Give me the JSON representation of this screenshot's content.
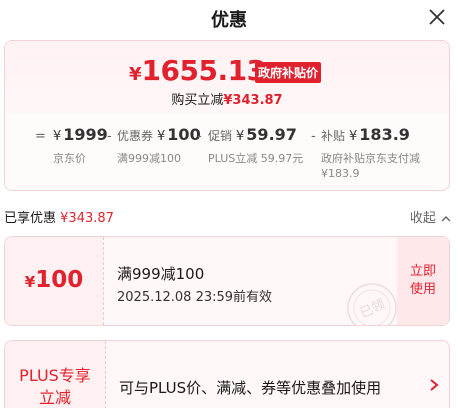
{
  "header": {
    "title": "优惠",
    "close_icon": "close-icon"
  },
  "price": {
    "currency": "¥",
    "final": "1655.13",
    "gov_tag": "政府补贴价",
    "buy_reduce_label": "购买立减",
    "buy_reduce_amount": "¥343.87"
  },
  "breakdown": [
    {
      "op": "=",
      "label": "",
      "currency": "¥",
      "value": "1999",
      "sub": "京东价"
    },
    {
      "op": "-",
      "label": "优惠券",
      "currency": "¥",
      "value": "100",
      "sub": "满999减100"
    },
    {
      "op": "-",
      "label": "促销",
      "currency": "¥",
      "value": "59.97",
      "sub": "PLUS立减 59.97元"
    },
    {
      "op": "-",
      "label": "补贴",
      "currency": "¥",
      "value": "183.9",
      "sub": "政府补贴京东支付减¥183.9"
    }
  ],
  "savings": {
    "label": "已享优惠",
    "amount": "¥343.87",
    "collapse_label": "收起"
  },
  "coupon": {
    "currency": "¥",
    "value": "100",
    "title": "满999减100",
    "valid": "2025.12.08 23:59前有效",
    "claim_label": "立即使用",
    "stamp_text": "已领"
  },
  "plus": {
    "title": "PLUS专享立减",
    "description": "可与PLUS价、满减、券等优惠叠加使用"
  },
  "colors": {
    "accent": "#e1222e",
    "card_border": "#f1d3d6"
  }
}
